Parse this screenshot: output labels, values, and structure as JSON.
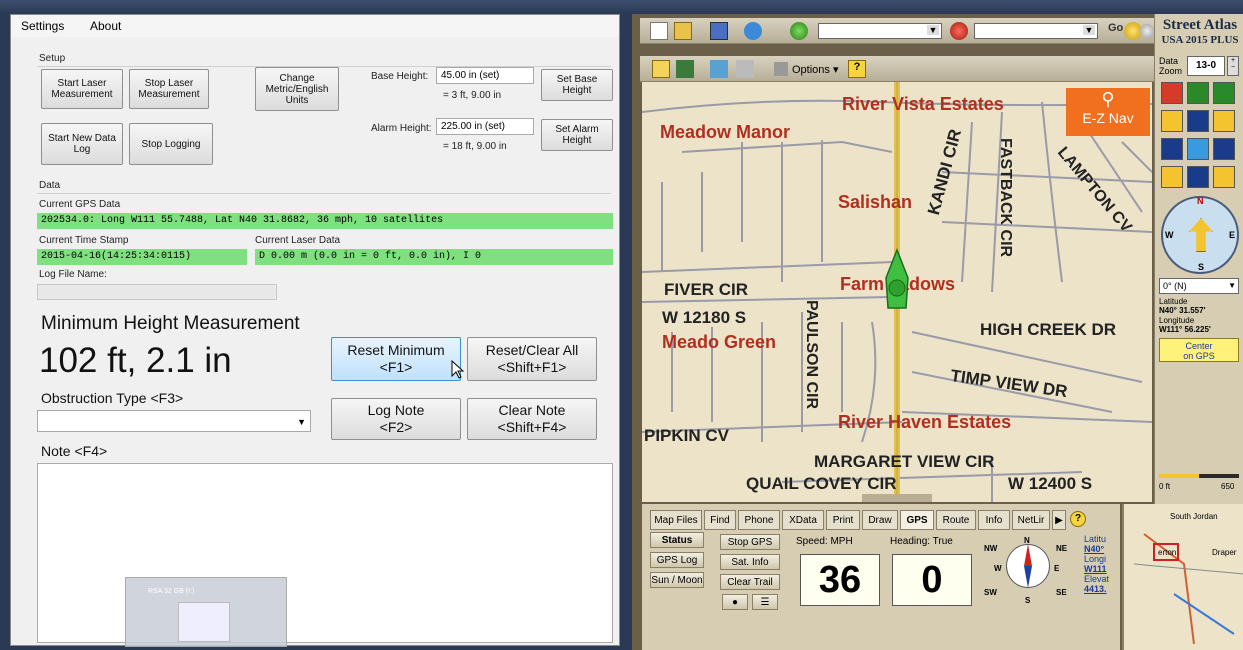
{
  "left": {
    "menu": {
      "settings": "Settings",
      "about": "About"
    },
    "setup": {
      "group_label": "Setup",
      "start_laser": "Start Laser\nMeasurement",
      "stop_laser": "Stop Laser\nMeasurement",
      "change_units": "Change\nMetric/English\nUnits",
      "base_height_label": "Base Height:",
      "base_height_value": "45.00 in (set)",
      "base_height_conv": "= 3 ft, 9.00 in",
      "set_base_height": "Set Base\nHeight",
      "start_new_log": "Start New Data\nLog",
      "stop_logging": "Stop Logging",
      "alarm_height_label": "Alarm Height:",
      "alarm_height_value": "225.00 in (set)",
      "alarm_height_conv": "= 18 ft, 9.00 in",
      "set_alarm_height": "Set Alarm\nHeight"
    },
    "data": {
      "group_label": "Data",
      "gps_label": "Current GPS Data",
      "gps_value": "202534.0: Long W111 55.7488, Lat N40 31.8682, 36 mph, 10 satellites",
      "time_label": "Current Time Stamp",
      "time_value": "2015-04-16(14:25:34:0115)",
      "laser_label": "Current Laser Data",
      "laser_value": "D 0.00 m (0.0 in = 0 ft, 0.0 in), I 0",
      "logfile_label": "Log File Name:",
      "logfile_value": ""
    },
    "min_height": {
      "title": "Minimum Height Measurement",
      "value": "102 ft, 2.1 in",
      "reset_min": "Reset Minimum\n<F1>",
      "reset_all": "Reset/Clear All\n<Shift+F1>"
    },
    "obstruction": {
      "label": "Obstruction Type <F3>",
      "value": ""
    },
    "log_note": "Log Note\n<F2>",
    "clear_note": "Clear Note\n<Shift+F4>",
    "note_label": "Note <F4>",
    "taskbar_thumb": "RSA 32 GB (I:)"
  },
  "right": {
    "brand_line1": "Street Atlas",
    "brand_line2": "USA 2015 PLUS",
    "options_label": "Options",
    "go_label": "Go",
    "data_zoom_label": "Data\nZoom",
    "data_zoom_value": "13-0",
    "ez_nav": "E-Z Nav",
    "compass_letters": {
      "n": "N",
      "s": "S",
      "e": "E",
      "w": "W"
    },
    "heading_select": "0° (N)",
    "latitude_label": "Latitude",
    "latitude_value": "N40° 31.557'",
    "longitude_label": "Longitude",
    "longitude_value": "W111° 56.225'",
    "center_gps": "Center\non GPS",
    "scale_left": "0 ft",
    "scale_right": "650",
    "map_labels": {
      "river_vista": "River Vista Estates",
      "meadow_manor": "Meadow Manor",
      "salishan": "Salishan",
      "kandi": "KANDI CIR",
      "fastback": "FASTBACK CIR",
      "lampton": "LAMPTON CV",
      "fiver": "FIVER CIR",
      "w12180": "W 12180 S",
      "meado_green": "Meado Green",
      "paulson": "PAULSON CIR",
      "farm_meadows": "Farm eadows",
      "high_creek": "HIGH CREEK DR",
      "timp_view": "TIMP VIEW DR",
      "river_haven": "River Haven Estates",
      "pipkin": "PIPKIN CV",
      "margaret": "MARGARET VIEW CIR",
      "quail": "QUAIL COVEY CIR",
      "w12400": "W 12400 S"
    },
    "tabs": [
      "Map Files",
      "Find",
      "Phone",
      "XData",
      "Print",
      "Draw",
      "GPS",
      "Route",
      "Info",
      "NetLir"
    ],
    "active_tab": "GPS",
    "gps_side": [
      "Status",
      "GPS Log",
      "Sun / Moon"
    ],
    "gps_actions": [
      "Stop GPS",
      "Sat. Info",
      "Clear Trail"
    ],
    "speed_label": "Speed: MPH",
    "heading_label": "Heading: True",
    "speed_value": "36",
    "heading_value": "0",
    "compass_rose": {
      "nw": "NW",
      "n": "N",
      "ne": "NE",
      "w": "W",
      "e": "E",
      "sw": "SW",
      "s": "S",
      "se": "SE"
    },
    "gps_readout": {
      "lat_label": "Latitu",
      "lat_value": "N40°",
      "lon_label": "Longi",
      "lon_value": "W111",
      "elev_label": "Elevat",
      "elev_value": "4413."
    },
    "minimap_labels": {
      "south_jordan": "South Jordan",
      "draper": "Draper",
      "erton": "erton"
    }
  }
}
